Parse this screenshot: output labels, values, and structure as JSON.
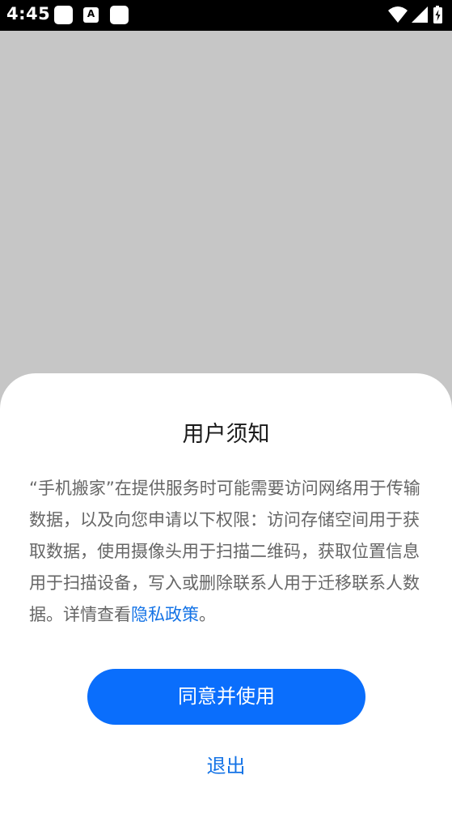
{
  "status_bar": {
    "time": "4:45",
    "notification_icons": [
      "app-notification-icon",
      "font-a-icon",
      "app-notification-icon"
    ],
    "notification_glyph": "A",
    "system_icons": [
      "wifi-icon",
      "cellular-signal-icon",
      "battery-icon"
    ]
  },
  "dialog": {
    "title": "用户须知",
    "body_text": "“手机搬家”在提供服务时可能需要访问网络用于传输数据，以及向您申请以下权限：访问存储空间用于获取数据，使用摄像头用于扫描二维码，获取位置信息用于扫描设备，写入或删除联系人用于迁移联系人数据。详情查看",
    "privacy_link_label": "隐私政策",
    "body_suffix": "。",
    "agree_button_label": "同意并使用",
    "exit_label": "退出"
  },
  "colors": {
    "backdrop": "#c6c6c6",
    "accent": "#0a6efc",
    "link": "#1473e6",
    "body_text": "#666666",
    "title_text": "#1a1a1a"
  }
}
